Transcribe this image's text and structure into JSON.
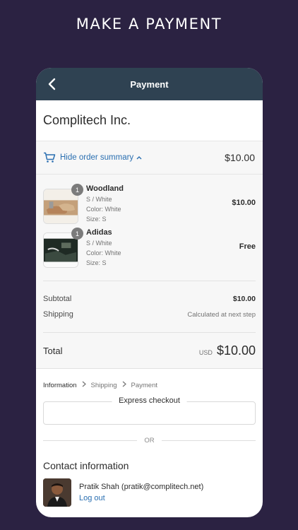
{
  "banner": {
    "title": "MAKE A PAYMENT"
  },
  "navbar": {
    "title": "Payment"
  },
  "store": {
    "name": "Complitech Inc."
  },
  "summary": {
    "toggle_label": "Hide order summary",
    "total": "$10.00"
  },
  "items": [
    {
      "name": "Woodland",
      "variant": "S / White",
      "color": "Color: White",
      "size": "Size: S",
      "price": "$10.00",
      "qty": "1"
    },
    {
      "name": "Adidas",
      "variant": "S / White",
      "color": "Color: White",
      "size": "Size: S",
      "price": "Free",
      "qty": "1"
    }
  ],
  "totals": {
    "subtotal_label": "Subtotal",
    "subtotal_value": "$10.00",
    "shipping_label": "Shipping",
    "shipping_value": "Calculated at next step",
    "total_label": "Total",
    "currency": "USD",
    "total_value": "$10.00"
  },
  "breadcrumb": [
    "Information",
    "Shipping",
    "Payment"
  ],
  "express": {
    "title": "Express checkout"
  },
  "divider": {
    "text": "OR"
  },
  "contact": {
    "title": "Contact information",
    "name": "Pratik Shah (pratik@complitech.net)",
    "logout": "Log out"
  },
  "colors": {
    "background": "#2b2242",
    "navbar": "#2f4252",
    "link": "#2a6fb1"
  }
}
